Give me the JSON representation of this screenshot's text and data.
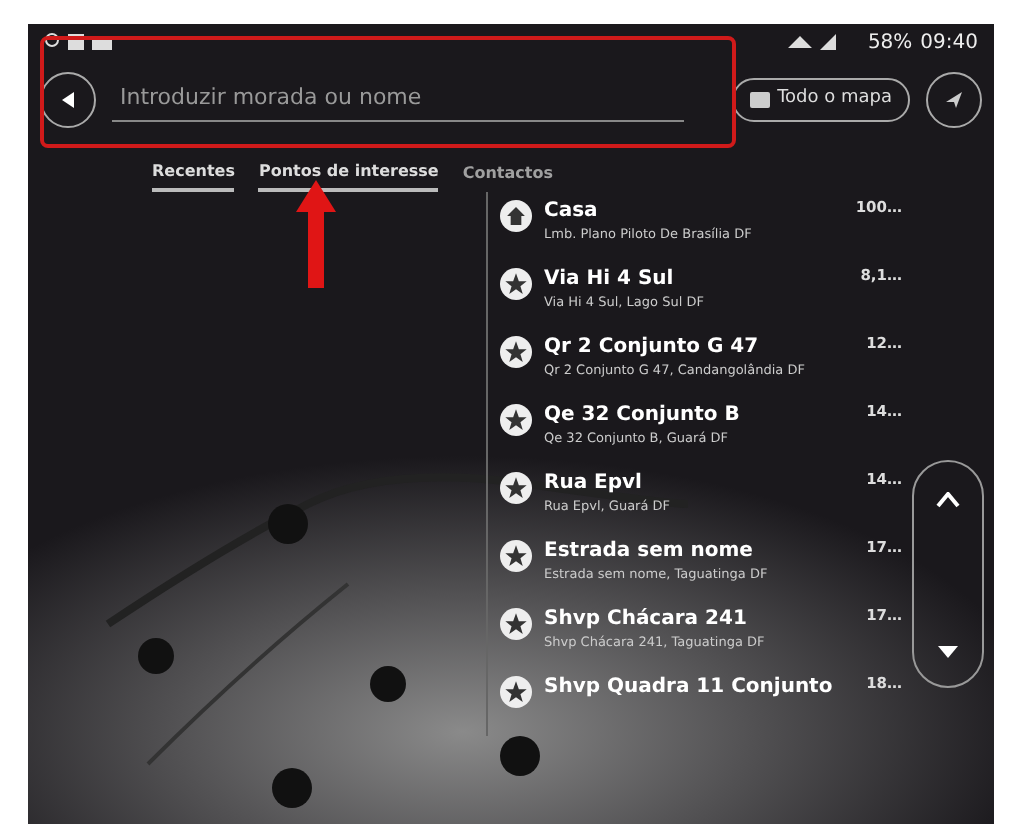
{
  "status_bar": {
    "battery": "58%",
    "time": "09:40"
  },
  "search": {
    "placeholder": "Introduzir morada ou nome",
    "map_button": "Todo o mapa"
  },
  "tabs": [
    {
      "label": "Recentes",
      "selected": true
    },
    {
      "label": "Pontos de interesse",
      "selected": true
    },
    {
      "label": "Contactos",
      "selected": false
    }
  ],
  "places": [
    {
      "kind": "home",
      "name": "Casa",
      "address": "Lmb. Plano Piloto De Brasília DF",
      "distance": "100…"
    },
    {
      "kind": "favorite",
      "name": "Via Hi 4 Sul",
      "address": "Via Hi 4 Sul, Lago Sul DF",
      "distance": "8,1…"
    },
    {
      "kind": "favorite",
      "name": "Qr 2 Conjunto G 47",
      "address": "Qr 2 Conjunto G 47, Candangolândia DF",
      "distance": "12…"
    },
    {
      "kind": "favorite",
      "name": "Qe 32 Conjunto B",
      "address": "Qe 32 Conjunto B, Guará DF",
      "distance": "14…"
    },
    {
      "kind": "favorite",
      "name": "Rua Epvl",
      "address": "Rua Epvl, Guará DF",
      "distance": "14…"
    },
    {
      "kind": "favorite",
      "name": "Estrada sem nome",
      "address": "Estrada sem nome, Taguatinga DF",
      "distance": "17…"
    },
    {
      "kind": "favorite",
      "name": "Shvp Chácara 241",
      "address": "Shvp Chácara 241, Taguatinga DF",
      "distance": "17…"
    },
    {
      "kind": "favorite",
      "name": "Shvp Quadra 11 Conjunto",
      "distance": "18…"
    }
  ]
}
